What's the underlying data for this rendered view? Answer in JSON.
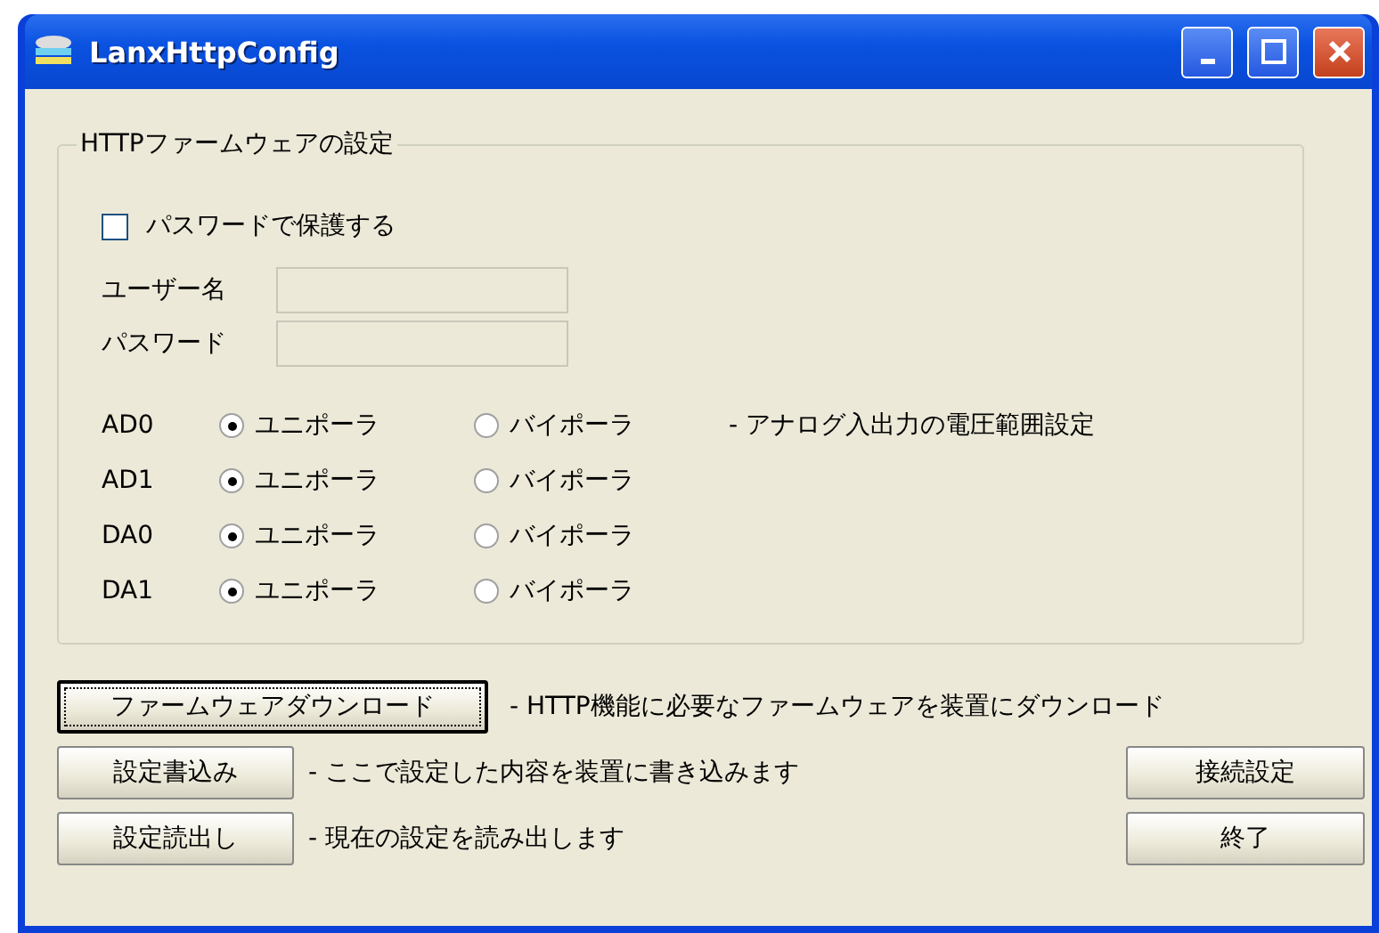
{
  "window": {
    "title": "LanxHttpConfig"
  },
  "group": {
    "title": "HTTPファームウェアの設定"
  },
  "password_protect": {
    "label": "パスワードで保護する",
    "checked": false
  },
  "fields": [
    {
      "label": "ユーザー名",
      "disabled": true
    },
    {
      "label": "パスワード",
      "disabled": true
    }
  ],
  "channels": [
    {
      "label": "AD0",
      "options": [
        {
          "label": "ユニポーラ",
          "selected": true
        },
        {
          "label": "バイポーラ",
          "selected": false
        }
      ]
    },
    {
      "label": "AD1",
      "options": [
        {
          "label": "ユニポーラ",
          "selected": true
        },
        {
          "label": "バイポーラ",
          "selected": false
        }
      ]
    },
    {
      "label": "DA0",
      "options": [
        {
          "label": "ユニポーラ",
          "selected": true
        },
        {
          "label": "バイポーラ",
          "selected": false
        }
      ]
    },
    {
      "label": "DA1",
      "options": [
        {
          "label": "ユニポーラ",
          "selected": true
        },
        {
          "label": "バイポーラ",
          "selected": false
        }
      ]
    }
  ],
  "range_note": "- アナログ入出力の電圧範囲設定",
  "download": {
    "button": "ファームウェアダウンロード",
    "note": "- HTTP機能に必要なファームウェアを装置にダウンロード"
  },
  "actions": [
    {
      "button": "設定書込み",
      "note": "- ここで設定した内容を装置に書き込みます",
      "side_button": "接続設定"
    },
    {
      "button": "設定読出し",
      "note": "- 現在の設定を読み出します",
      "side_button": "終了"
    }
  ]
}
